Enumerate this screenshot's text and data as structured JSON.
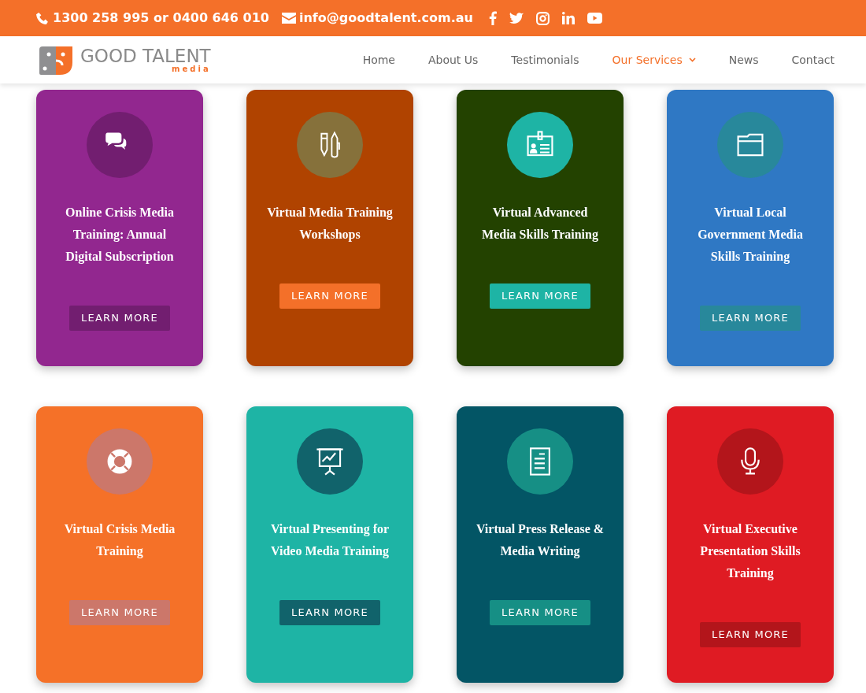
{
  "top_bar": {
    "phone": "1300 258 995 or 0400 646 010",
    "email": "info@goodtalent.com.au"
  },
  "logo": {
    "name": "GOOD TALENT",
    "tagline": "media"
  },
  "nav": [
    {
      "label": "Home",
      "selected": false
    },
    {
      "label": "About Us",
      "selected": false
    },
    {
      "label": "Testimonials",
      "selected": false
    },
    {
      "label": "Our Services",
      "selected": true,
      "has_menu": true
    },
    {
      "label": "News",
      "selected": false
    },
    {
      "label": "Contact",
      "selected": false
    }
  ],
  "cards": [
    {
      "title": "Online Crisis Media Training: Annual Digital Subscription",
      "color": "#92278f",
      "circle": {
        "color": "#721e70"
      },
      "button": {
        "label": "LEARN MORE",
        "color": "#721e70"
      }
    },
    {
      "title": "Virtual Media Training Workshops",
      "color": "#b04300",
      "circle": {
        "color": "#86713b"
      },
      "button": {
        "label": "LEARN MORE",
        "color": "#f47029"
      }
    },
    {
      "title": "Virtual Advanced Media Skills Training",
      "color": "#234200",
      "circle": {
        "color": "#1eb4a5"
      },
      "button": {
        "label": "LEARN MORE",
        "color": "#1eb4a5"
      }
    },
    {
      "title": "Virtual Local Government Media Skills Training",
      "color": "#2f78c4",
      "circle": {
        "color": "#28889b"
      },
      "button": {
        "label": "LEARN MORE",
        "color": "#28889b"
      }
    },
    {
      "title": "Virtual Crisis Media Training",
      "color": "#f57128",
      "circle": {
        "color": "#cc776a"
      },
      "button": {
        "label": "LEARN MORE",
        "color": "#cc776a"
      }
    },
    {
      "title": "Virtual Presenting for Video Media Training",
      "color": "#1eb4a5",
      "circle": {
        "color": "#11636b"
      },
      "button": {
        "label": "LEARN MORE",
        "color": "#11636b"
      }
    },
    {
      "title": "Virtual Press Release & Media Writing",
      "color": "#035565",
      "circle": {
        "color": "#168f85"
      },
      "button": {
        "label": "LEARN MORE",
        "color": "#168f85"
      }
    },
    {
      "title": "Virtual Executive Presentation Skills Training",
      "color": "#df1b23",
      "circle": {
        "color": "#b3151b"
      },
      "button": {
        "label": "LEARN MORE",
        "color": "#b3151b"
      }
    }
  ]
}
